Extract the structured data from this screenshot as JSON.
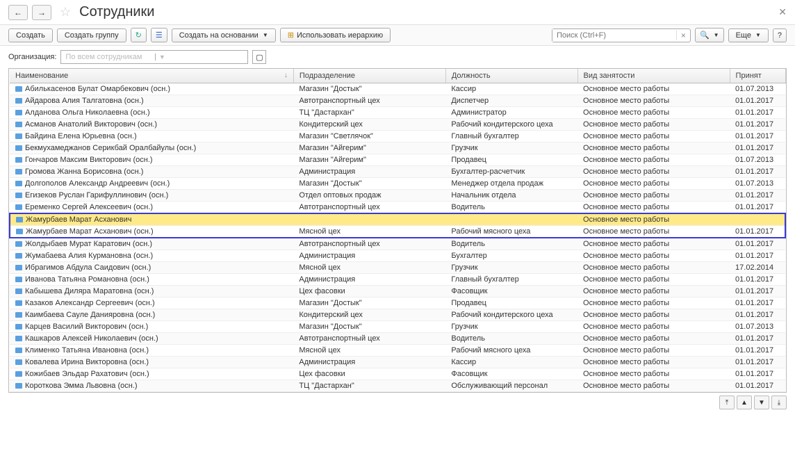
{
  "header": {
    "title": "Сотрудники"
  },
  "toolbar": {
    "create": "Создать",
    "create_group": "Создать группу",
    "create_based": "Создать на основании",
    "use_hierarchy": "Использовать иерархию",
    "search_placeholder": "Поиск (Ctrl+F)",
    "more": "Еще"
  },
  "filter": {
    "org_label": "Организация:",
    "org_placeholder": "По всем сотрудникам"
  },
  "columns": {
    "name": "Наименование",
    "department": "Подразделение",
    "position": "Должность",
    "employment": "Вид занятости",
    "hired": "Принят"
  },
  "employment_main": "Основное место работы",
  "rows": [
    {
      "name": "Абилькасенов Булат Омарбекович (осн.)",
      "dept": "Магазин \"Достык\"",
      "post": "Кассир",
      "emp": "Основное место работы",
      "date": "01.07.2013"
    },
    {
      "name": "Айдарова Алия Талгатовна (осн.)",
      "dept": "Автотранспортный цех",
      "post": "Диспетчер",
      "emp": "Основное место работы",
      "date": "01.01.2017"
    },
    {
      "name": "Алданова Ольга Николаевна (осн.)",
      "dept": "ТЦ \"Дастархан\"",
      "post": "Администратор",
      "emp": "Основное место работы",
      "date": "01.01.2017"
    },
    {
      "name": "Асманов Анатолий Викторович (осн.)",
      "dept": "Кондитерский цех",
      "post": "Рабочий кондитерского цеха",
      "emp": "Основное место работы",
      "date": "01.01.2017"
    },
    {
      "name": "Байдина Елена Юрьевна (осн.)",
      "dept": "Магазин \"Светлячок\"",
      "post": "Главный бухгалтер",
      "emp": "Основное место работы",
      "date": "01.01.2017"
    },
    {
      "name": "Бекмухамеджанов Серикбай Оралбайулы (осн.)",
      "dept": "Магазин \"Айгерим\"",
      "post": "Грузчик",
      "emp": "Основное место работы",
      "date": "01.01.2017"
    },
    {
      "name": "Гончаров Максим Викторович (осн.)",
      "dept": "Магазин \"Айгерим\"",
      "post": "Продавец",
      "emp": "Основное место работы",
      "date": "01.07.2013"
    },
    {
      "name": "Громова Жанна Борисовна (осн.)",
      "dept": "Администрация",
      "post": "Бухгалтер-расчетчик",
      "emp": "Основное место работы",
      "date": "01.01.2017"
    },
    {
      "name": "Долгополов Александр Андреевич (осн.)",
      "dept": "Магазин \"Достык\"",
      "post": "Менеджер отдела продаж",
      "emp": "Основное место работы",
      "date": "01.07.2013"
    },
    {
      "name": "Егизеков Руслан Гарифуллинович (осн.)",
      "dept": "Отдел оптовых продаж",
      "post": "Начальник отдела",
      "emp": "Основное место работы",
      "date": "01.01.2017"
    },
    {
      "name": "Еременко Сергей Алексеевич (осн.)",
      "dept": "Автотранспортный цех",
      "post": "Водитель",
      "emp": "Основное место работы",
      "date": "01.01.2017"
    },
    {
      "name": "Жамурбаев Марат Асханович",
      "dept": "",
      "post": "",
      "emp": "Основное место работы",
      "date": "",
      "sel": "yellow"
    },
    {
      "name": "Жамурбаев Марат Асханович (осн.)",
      "dept": "Мясной цех",
      "post": "Рабочий мясного цеха",
      "emp": "Основное место работы",
      "date": "01.01.2017",
      "sel": "end"
    },
    {
      "name": "Жолдыбаев Мурат Каратович (осн.)",
      "dept": "Автотранспортный цех",
      "post": "Водитель",
      "emp": "Основное место работы",
      "date": "01.01.2017"
    },
    {
      "name": "Жумабаева Алия Курмановна (осн.)",
      "dept": "Администрация",
      "post": "Бухгалтер",
      "emp": "Основное место работы",
      "date": "01.01.2017"
    },
    {
      "name": "Ибрагимов Абдула Саидович (осн.)",
      "dept": "Мясной цех",
      "post": "Грузчик",
      "emp": "Основное место работы",
      "date": "17.02.2014"
    },
    {
      "name": "Иванова Татьяна Романовна (осн.)",
      "dept": "Администрация",
      "post": "Главный бухгалтер",
      "emp": "Основное место работы",
      "date": "01.01.2017"
    },
    {
      "name": "Кабышева Диляра Маратовна (осн.)",
      "dept": "Цех фасовки",
      "post": "Фасовщик",
      "emp": "Основное место работы",
      "date": "01.01.2017"
    },
    {
      "name": "Казаков Александр Сергеевич (осн.)",
      "dept": "Магазин \"Достык\"",
      "post": "Продавец",
      "emp": "Основное место работы",
      "date": "01.01.2017"
    },
    {
      "name": "Каимбаева Сауле Данияровна (осн.)",
      "dept": "Кондитерский цех",
      "post": "Рабочий кондитерского цеха",
      "emp": "Основное место работы",
      "date": "01.01.2017"
    },
    {
      "name": "Карцев Василий Викторович (осн.)",
      "dept": "Магазин \"Достык\"",
      "post": "Грузчик",
      "emp": "Основное место работы",
      "date": "01.07.2013"
    },
    {
      "name": "Кашкаров Алексей Николаевич (осн.)",
      "dept": "Автотранспортный цех",
      "post": "Водитель",
      "emp": "Основное место работы",
      "date": "01.01.2017"
    },
    {
      "name": "Клименко Татьяна Ивановна (осн.)",
      "dept": "Мясной цех",
      "post": "Рабочий мясного цеха",
      "emp": "Основное место работы",
      "date": "01.01.2017"
    },
    {
      "name": "Ковалева Ирина Викторовна (осн.)",
      "dept": "Администрация",
      "post": "Кассир",
      "emp": "Основное место работы",
      "date": "01.01.2017"
    },
    {
      "name": "Кожибаев Эльдар Рахатович (осн.)",
      "dept": "Цех фасовки",
      "post": "Фасовщик",
      "emp": "Основное место работы",
      "date": "01.01.2017"
    },
    {
      "name": "Короткова Эмма Львовна (осн.)",
      "dept": "ТЦ \"Дастархан\"",
      "post": "Обслуживающий персонал",
      "emp": "Основное место работы",
      "date": "01.01.2017"
    }
  ]
}
